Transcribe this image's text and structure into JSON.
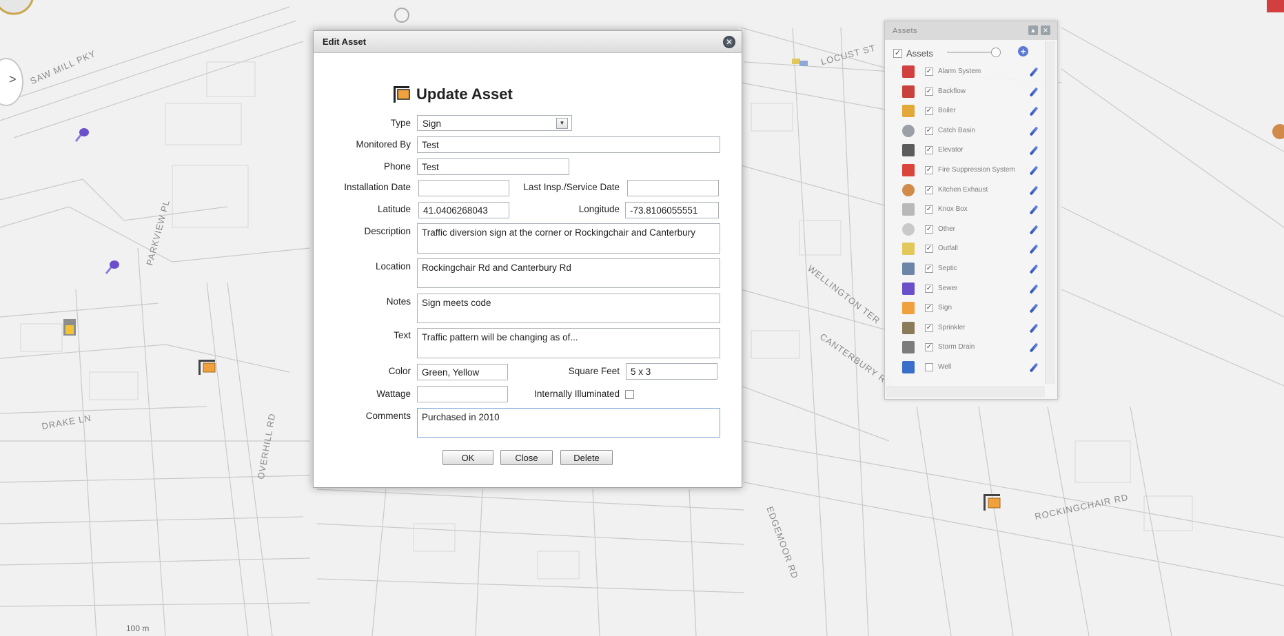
{
  "map": {
    "street_labels": [
      {
        "id": "saw-mill-pky",
        "text": "SAW MILL PKY"
      },
      {
        "id": "locust-st",
        "text": "LOCUST ST"
      },
      {
        "id": "drake-ln",
        "text": "DRAKE LN"
      },
      {
        "id": "rockingchair-rd",
        "text": "ROCKINGCHAIR RD"
      },
      {
        "id": "canterbury-rd",
        "text": "CANTERBURY RD"
      },
      {
        "id": "wellington-ter",
        "text": "WELLINGTON TER"
      },
      {
        "id": "overhill-rd",
        "text": "OVERHILL RD"
      },
      {
        "id": "parkview-pl",
        "text": "PARKVIEW PL"
      },
      {
        "id": "edgemoor-rd",
        "text": "EDGEMOOR RD"
      }
    ],
    "scale_text": "100 m"
  },
  "modal": {
    "title": "Edit Asset",
    "close_glyph": "✕",
    "heading": "Update Asset",
    "labels": {
      "type": "Type",
      "monitored_by": "Monitored By",
      "phone": "Phone",
      "installation_date": "Installation Date",
      "last_insp": "Last Insp./Service Date",
      "latitude": "Latitude",
      "longitude": "Longitude",
      "description": "Description",
      "location": "Location",
      "notes": "Notes",
      "text": "Text",
      "color": "Color",
      "square_feet": "Square Feet",
      "wattage": "Wattage",
      "internally_illuminated": "Internally Illuminated",
      "comments": "Comments"
    },
    "values": {
      "type": "Sign",
      "monitored_by": "Test",
      "phone": "Test",
      "installation_date": "",
      "last_insp": "",
      "latitude": "41.0406268043",
      "longitude": "-73.8106055551",
      "description": "Traffic diversion sign at the corner or Rockingchair and Canterbury",
      "location": "Rockingchair Rd and Canterbury Rd",
      "notes": "Sign meets code",
      "text": "Traffic pattern will be changing as of...",
      "color": "Green, Yellow",
      "square_feet": "5 x 3",
      "wattage": "",
      "comments": "Purchased in 2010"
    },
    "buttons": {
      "ok": "OK",
      "close": "Close",
      "delete": "Delete"
    }
  },
  "assets_panel": {
    "title": "Assets",
    "root_label": "Assets",
    "items": [
      {
        "name": "Alarm System",
        "checked": true,
        "icon": "alarm-icon",
        "color": "#d13f3f"
      },
      {
        "name": "Backflow",
        "checked": true,
        "icon": "backflow-icon",
        "color": "#c8413d"
      },
      {
        "name": "Boiler",
        "checked": true,
        "icon": "boiler-icon",
        "color": "#e3a83a"
      },
      {
        "name": "Catch Basin",
        "checked": true,
        "icon": "catch-basin-icon",
        "color": "#9aa0a6"
      },
      {
        "name": "Elevator",
        "checked": true,
        "icon": "elevator-icon",
        "color": "#5c5c5c"
      },
      {
        "name": "Fire Suppression System",
        "checked": true,
        "icon": "fire-extinguisher-icon",
        "color": "#d9453a"
      },
      {
        "name": "Kitchen Exhaust",
        "checked": true,
        "icon": "kitchen-exhaust-icon",
        "color": "#d18a4a"
      },
      {
        "name": "Knox Box",
        "checked": true,
        "icon": "knox-box-icon",
        "color": "#b9b9b9"
      },
      {
        "name": "Other",
        "checked": true,
        "icon": "pin-icon",
        "color": "#c9c9c9"
      },
      {
        "name": "Outfall",
        "checked": true,
        "icon": "outfall-icon",
        "color": "#e2c85a"
      },
      {
        "name": "Septic",
        "checked": true,
        "icon": "septic-icon",
        "color": "#6d86a8"
      },
      {
        "name": "Sewer",
        "checked": true,
        "icon": "sewer-icon",
        "color": "#6a4fc9"
      },
      {
        "name": "Sign",
        "checked": true,
        "icon": "sign-icon",
        "color": "#f0a03c"
      },
      {
        "name": "Sprinkler",
        "checked": true,
        "icon": "sprinkler-icon",
        "color": "#8a7b5a"
      },
      {
        "name": "Storm Drain",
        "checked": true,
        "icon": "storm-drain-icon",
        "color": "#7c7c7c"
      },
      {
        "name": "Well",
        "checked": false,
        "icon": "well-icon",
        "color": "#3a6fc9"
      }
    ]
  },
  "colors": {
    "sign_orange": "#f0a03c",
    "accent_blue": "#5d79d6"
  }
}
